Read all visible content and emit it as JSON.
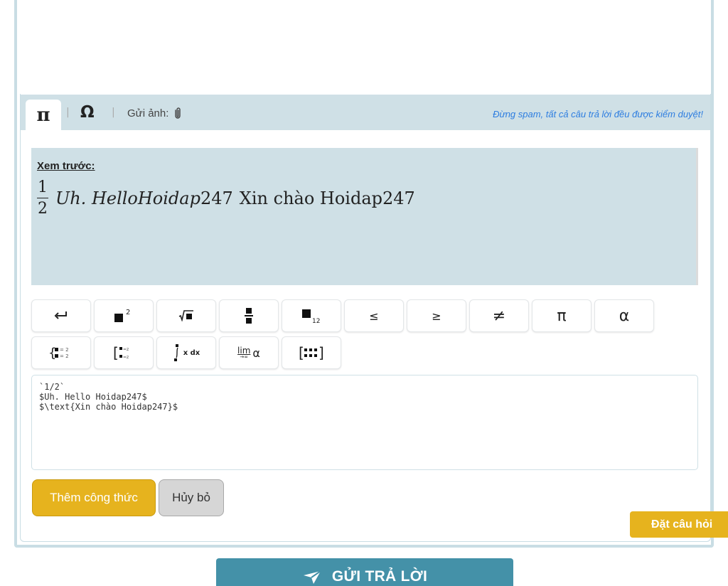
{
  "editor_toolbar": {
    "math_tab_symbol": "π",
    "separator": "|",
    "special_char_tab_symbol": "Ω",
    "send_image_label": "Gửi ảnh:",
    "spam_notice": "Đừng spam, tất cả câu trả lời đều được kiểm duyệt!"
  },
  "preview": {
    "label": "Xem trước:",
    "fraction_numerator": "1",
    "fraction_denominator": "2",
    "math_italic_text": "Uh. HelloHoidap",
    "math_number": "247",
    "plain_text": "Xin chào Hoidap247"
  },
  "symbols_row1": {
    "leq": "≤",
    "geq": "≥",
    "neq": "≠",
    "pi": "π",
    "alpha": "α"
  },
  "symbols_row2": {
    "integral_label": "x dx",
    "limit_label": "lim",
    "limit_sub": "→∞",
    "limit_alpha": "α"
  },
  "icons": {
    "enter": "enter-icon",
    "power": "power-icon",
    "root": "nth-root-icon",
    "fraction": "fraction-icon",
    "subscript": "subscript-icon",
    "system": "system-of-equations-icon",
    "matrix": "matrix-icon",
    "paperclip": "paperclip-icon",
    "send": "send-plane-icon"
  },
  "editor": {
    "line1": "`1/2`",
    "line2": "$Uh. Hello Hoidap247$",
    "line3": "$\\text{Xin chào Hoidap247}$"
  },
  "actions": {
    "add_formula": "Thêm công thức",
    "cancel": "Hủy bỏ"
  },
  "floating": {
    "ask_question": "Đặt câu hỏi"
  },
  "submit": {
    "label": "GỬI TRẢ LỜI"
  },
  "colors": {
    "accent_yellow": "#e6b31e",
    "panel_blue": "#cfe0e6",
    "submit_teal": "#4491a8",
    "notice_blue": "#2d7de0"
  }
}
